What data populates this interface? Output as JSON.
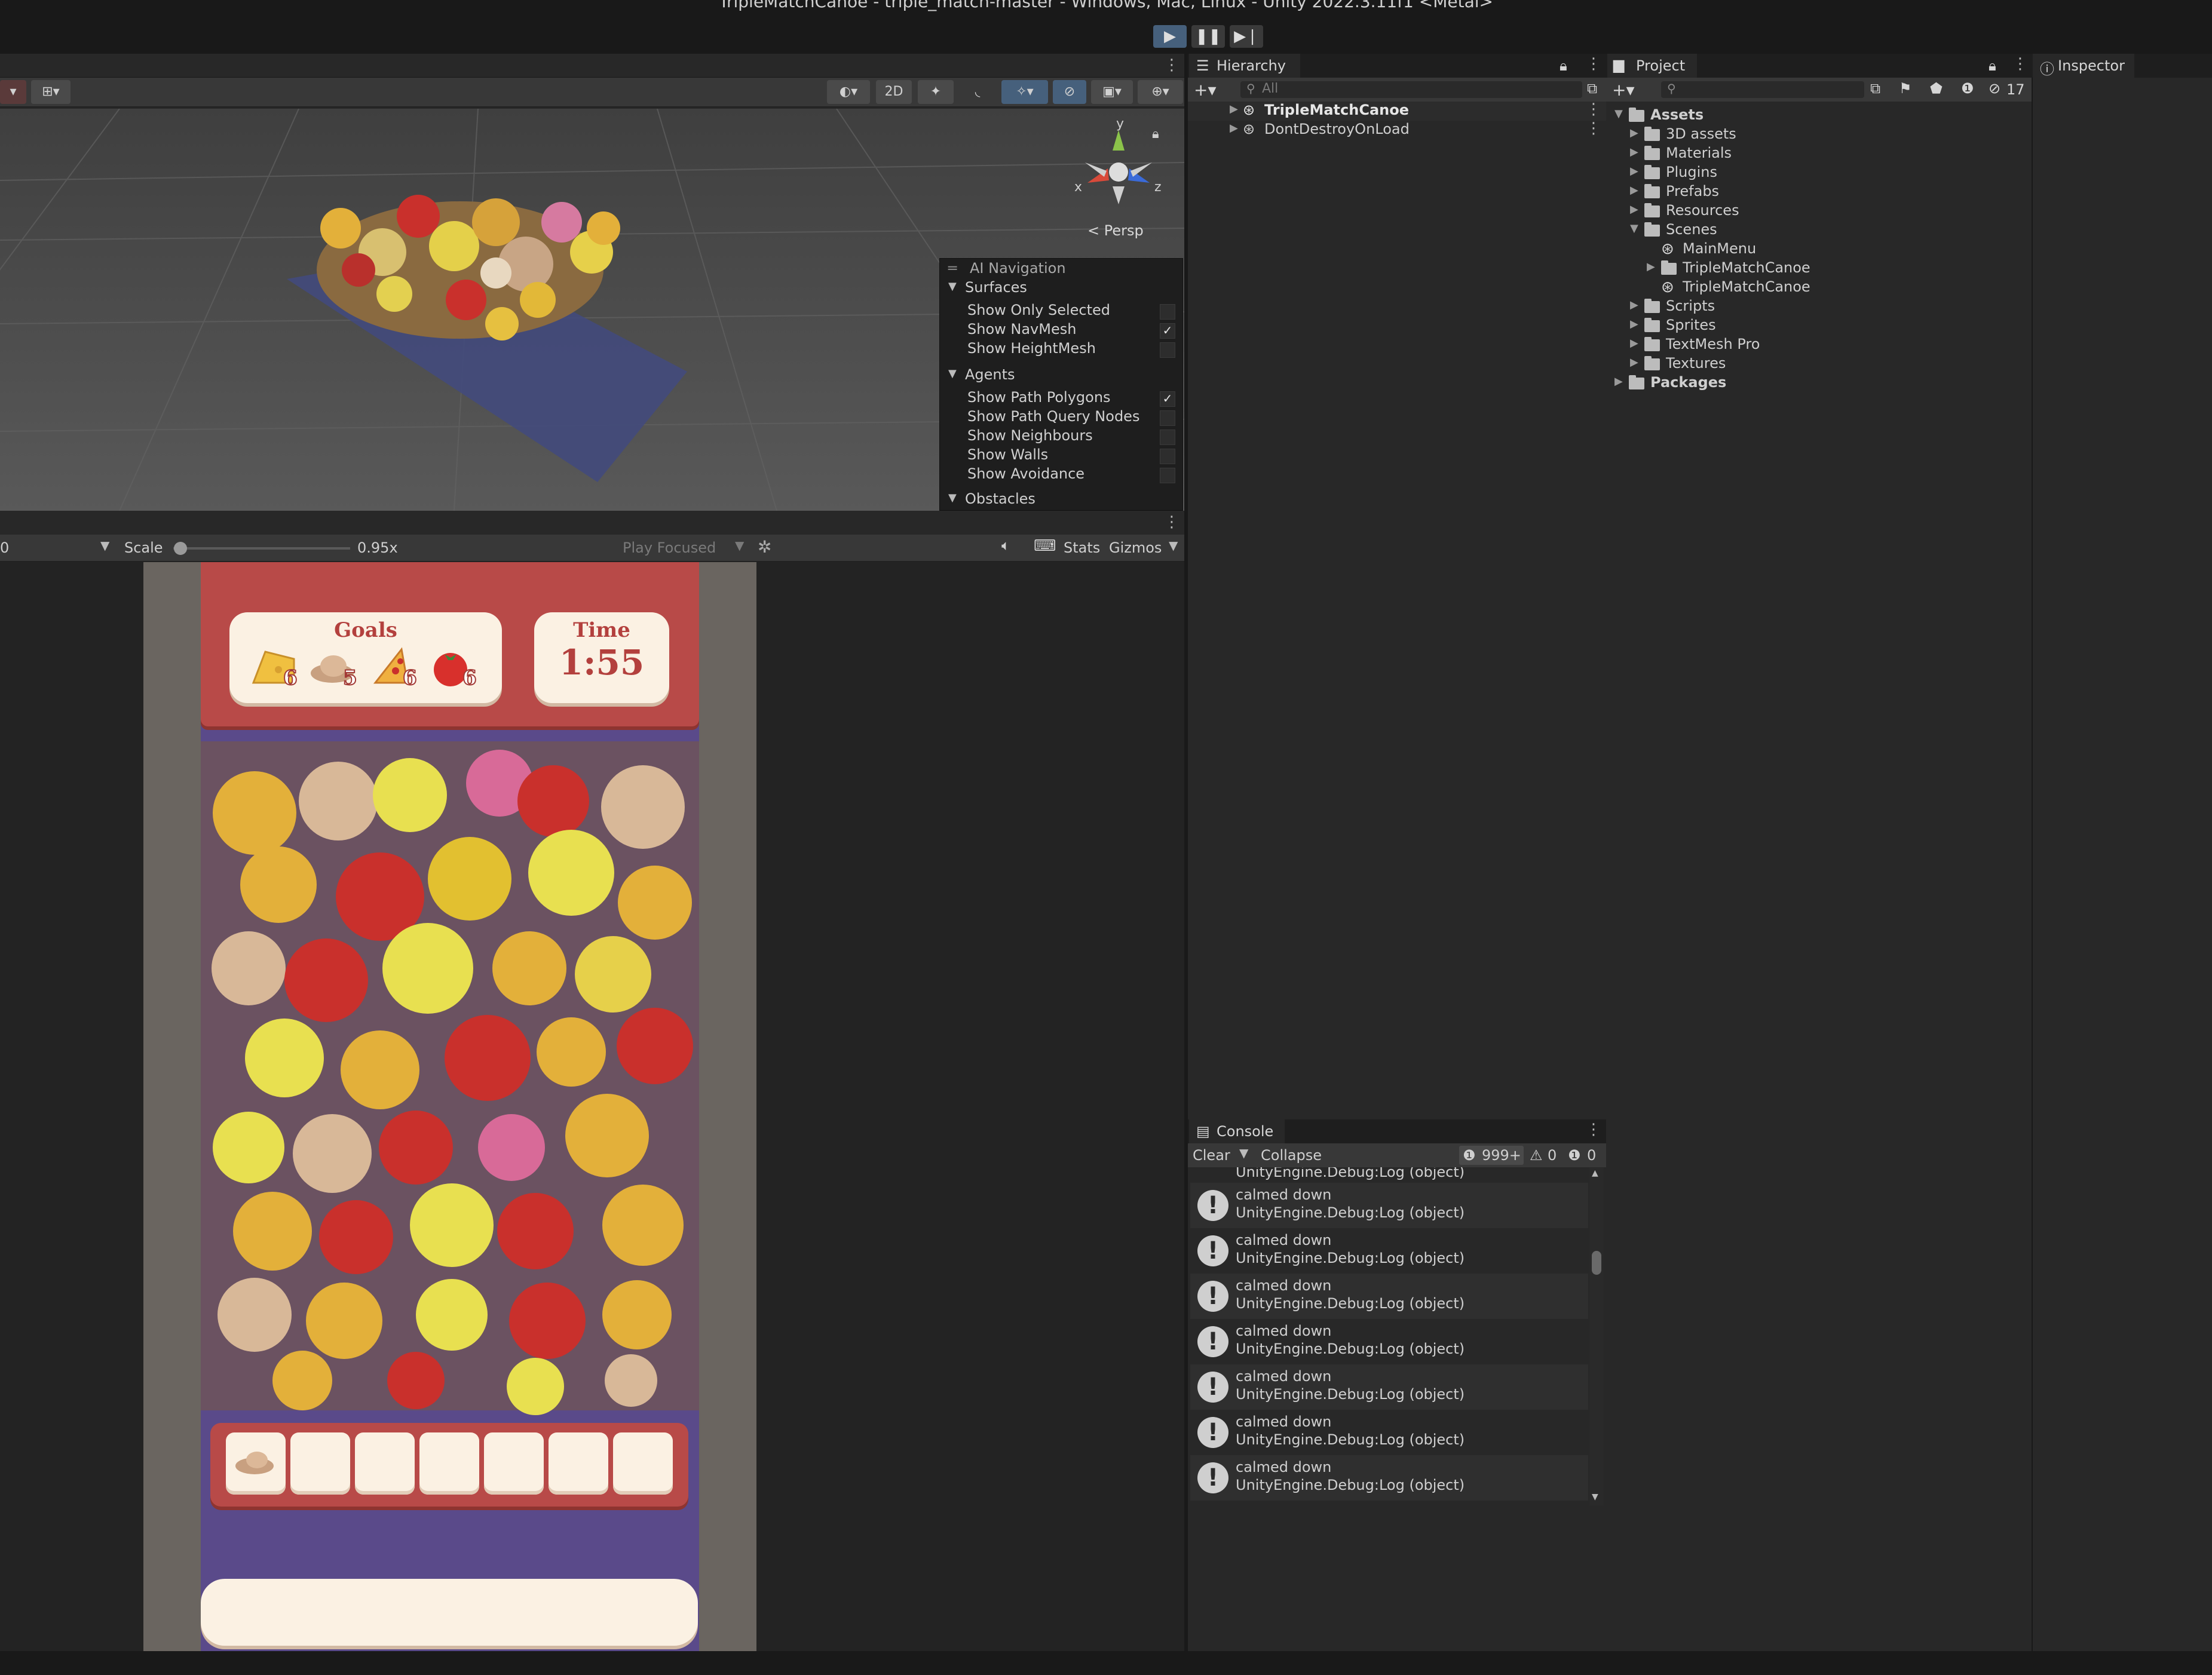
{
  "window": {
    "title": "TripleMatchCanoe - triple_match-master - Windows, Mac, Linux - Unity 2022.3.11f1 <Metal>"
  },
  "toolbar": {
    "play_icon": "play-icon",
    "pause_icon": "pause-icon",
    "step_icon": "step-icon"
  },
  "scene": {
    "mode_2d": "2D",
    "gizmo_y": "y",
    "gizmo_x": "x",
    "gizmo_z": "z",
    "persp_label": "Persp",
    "ai_nav": {
      "title": "AI Navigation",
      "surfaces_header": "Surfaces",
      "surfaces": [
        {
          "label": "Show Only Selected",
          "checked": ""
        },
        {
          "label": "Show NavMesh",
          "checked": "✓"
        },
        {
          "label": "Show HeightMesh",
          "checked": ""
        }
      ],
      "agents_header": "Agents",
      "agents": [
        {
          "label": "Show Path Polygons",
          "checked": "✓"
        },
        {
          "label": "Show Path Query Nodes",
          "checked": ""
        },
        {
          "label": "Show Neighbours",
          "checked": ""
        },
        {
          "label": "Show Walls",
          "checked": ""
        },
        {
          "label": "Show Avoidance",
          "checked": ""
        }
      ],
      "obstacles_header": "Obstacles"
    }
  },
  "game_toolbar": {
    "display_value": "0",
    "scale_label": "Scale",
    "scale_value": "0.95x",
    "scale_fraction": 0.04,
    "play_focused": "Play Focused",
    "stats": "Stats",
    "gizmos": "Gizmos"
  },
  "game": {
    "goals_title": "Goals",
    "goals": [
      {
        "icon": "cheese-icon",
        "count": "6"
      },
      {
        "icon": "hat-icon",
        "count": "5"
      },
      {
        "icon": "pizza-icon",
        "count": "6"
      },
      {
        "icon": "tomato-icon",
        "count": "6"
      }
    ],
    "time_title": "Time",
    "time_value": "1:55",
    "tray_first_item": "hat-icon"
  },
  "hierarchy": {
    "tab": "Hierarchy",
    "search_placeholder": "All",
    "items": [
      "TripleMatchCanoe",
      "DontDestroyOnLoad"
    ]
  },
  "console": {
    "tab": "Console",
    "clear": "Clear",
    "collapse": "Collapse",
    "log_count": "999+",
    "warn_count": "0",
    "error_count": "0",
    "partial_top": "UnityEngine.Debug:Log (object)",
    "entries": [
      {
        "message": "calmed down",
        "detail": "UnityEngine.Debug:Log (object)"
      },
      {
        "message": "calmed down",
        "detail": "UnityEngine.Debug:Log (object)"
      },
      {
        "message": "calmed down",
        "detail": "UnityEngine.Debug:Log (object)"
      },
      {
        "message": "calmed down",
        "detail": "UnityEngine.Debug:Log (object)"
      },
      {
        "message": "calmed down",
        "detail": "UnityEngine.Debug:Log (object)"
      },
      {
        "message": "calmed down",
        "detail": "UnityEngine.Debug:Log (object)"
      },
      {
        "message": "calmed down",
        "detail": "UnityEngine.Debug:Log (object)"
      }
    ]
  },
  "project": {
    "tab": "Project",
    "hidden_count": "17",
    "assets_label": "Assets",
    "folders": [
      "3D assets",
      "Materials",
      "Plugins",
      "Prefabs",
      "Resources"
    ],
    "scenes_label": "Scenes",
    "scene_files": [
      "MainMenu",
      "TripleMatchCanoe",
      "TripleMatchCanoe"
    ],
    "folders_after": [
      "Scripts",
      "Sprites",
      "TextMesh Pro",
      "Textures"
    ],
    "packages_label": "Packages"
  },
  "inspector": {
    "tab": "Inspector"
  },
  "colors": {
    "editor_bg": "#282828",
    "viewport_bg": "#4f4f4f",
    "goals_red": "#b84a48",
    "card_cream": "#fbf1e3",
    "board_purple": "#5a4a8a",
    "play_blue": "#46607c"
  }
}
